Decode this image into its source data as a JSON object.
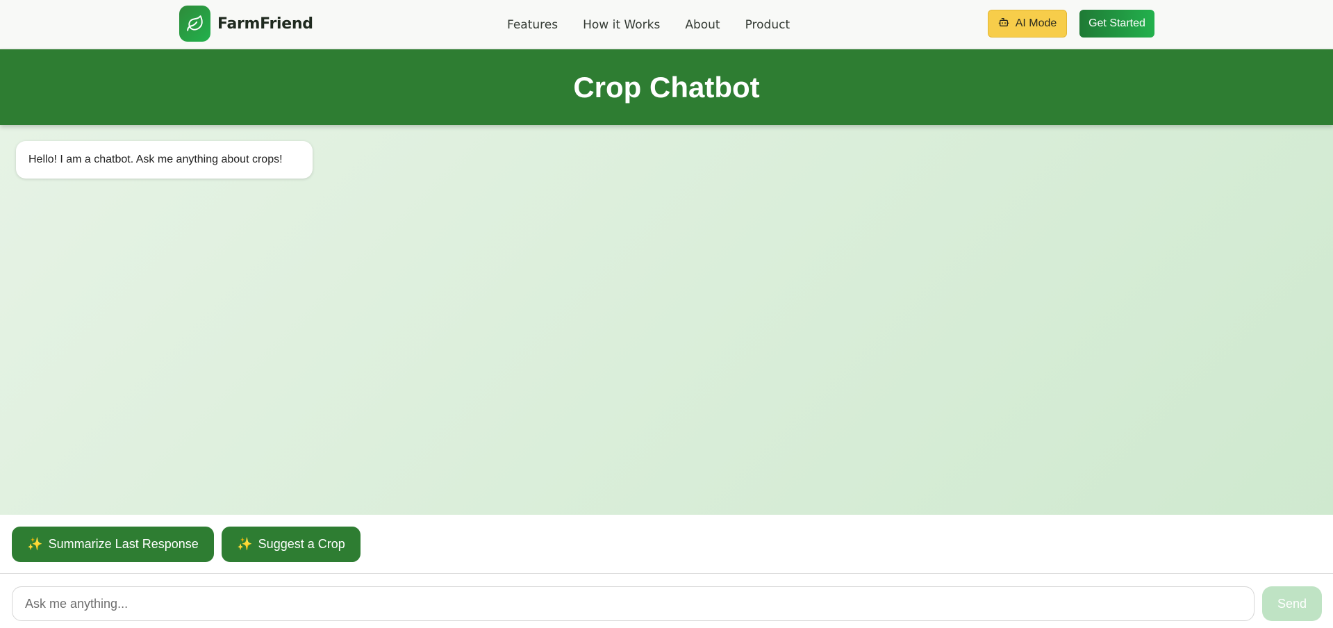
{
  "navbar": {
    "brand": {
      "name": "FarmFriend",
      "logo_icon": "leaf-icon"
    },
    "links": [
      "Features",
      "How it Works",
      "About",
      "Product"
    ],
    "ai_mode": {
      "label": "AI Mode",
      "icon": "robot-icon"
    },
    "get_started": {
      "label": "Get Started"
    }
  },
  "header": {
    "title": "Crop Chatbot"
  },
  "chat": {
    "messages": [
      {
        "sender": "bot",
        "text": "Hello! I am a chatbot. Ask me anything about crops!"
      }
    ]
  },
  "actions": {
    "summarize": {
      "icon": "sparkles-icon",
      "glyph": "✨",
      "label": "Summarize Last Response"
    },
    "suggest": {
      "icon": "sparkles-icon",
      "glyph": "✨",
      "label": "Suggest a Crop"
    }
  },
  "composer": {
    "placeholder": "Ask me anything...",
    "value": "",
    "send_label": "Send"
  },
  "colors": {
    "primary_green": "#2e7d32",
    "accent_yellow": "#f7cd4a",
    "send_disabled": "#bfe3c4"
  }
}
